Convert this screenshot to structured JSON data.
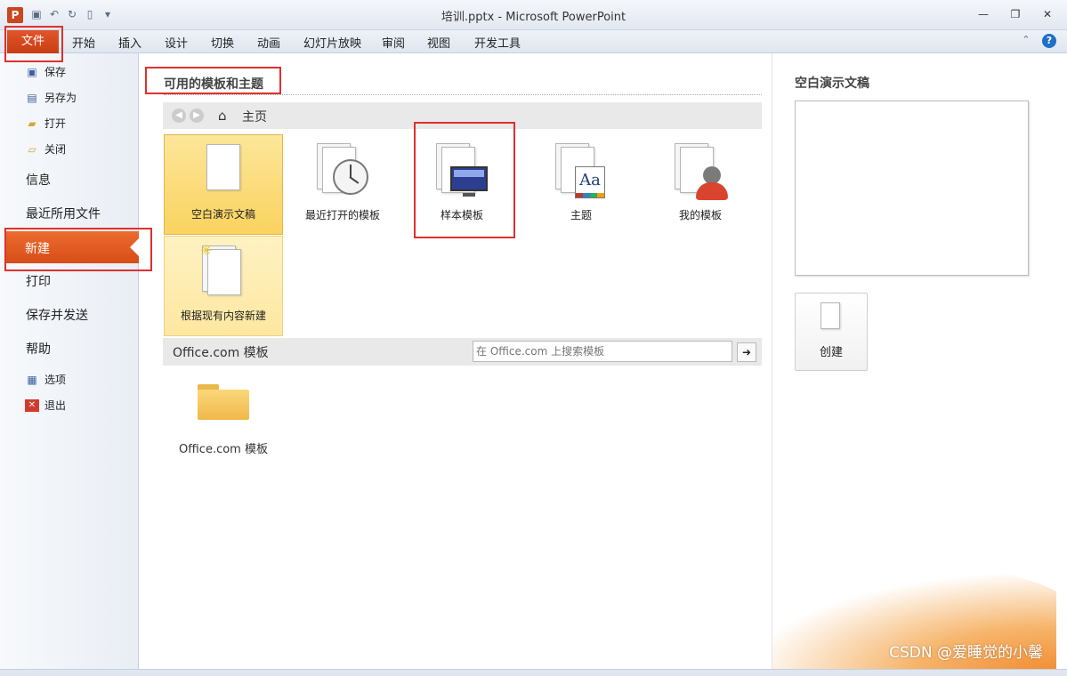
{
  "window": {
    "title": "培训.pptx - Microsoft PowerPoint",
    "app_icon_letter": "P",
    "icons": [
      "save-icon",
      "undo-icon",
      "redo-icon",
      "new-icon",
      "customize-qat-icon",
      "minimize-icon",
      "restore-icon",
      "close-icon"
    ]
  },
  "ribbon": {
    "file_tab": "文件",
    "tabs": [
      "开始",
      "插入",
      "设计",
      "切换",
      "动画",
      "幻灯片放映",
      "审阅",
      "视图",
      "开发工具"
    ]
  },
  "backstage_nav": {
    "save": "保存",
    "save_as": "另存为",
    "open": "打开",
    "close": "关闭",
    "info": "信息",
    "recent": "最近所用文件",
    "new": "新建",
    "print": "打印",
    "save_send": "保存并发送",
    "help": "帮助",
    "options": "选项",
    "exit": "退出"
  },
  "templates": {
    "section_title": "可用的模板和主题",
    "breadcrumb_home": "主页",
    "tiles": [
      {
        "label": "空白演示文稿",
        "icon": "blank-document-icon"
      },
      {
        "label": "最近打开的模板",
        "icon": "recent-templates-clock-icon"
      },
      {
        "label": "样本模板",
        "icon": "sample-templates-monitor-icon"
      },
      {
        "label": "主题",
        "icon": "themes-aa-icon"
      },
      {
        "label": "我的模板",
        "icon": "my-templates-person-icon"
      },
      {
        "label": "根据现有内容新建",
        "icon": "new-from-existing-icon"
      }
    ],
    "office_section_title": "Office.com 模板",
    "search_placeholder": "在 Office.com 上搜索模板",
    "office_folder_label": "Office.com 模板"
  },
  "preview": {
    "title": "空白演示文稿",
    "create_label": "创建"
  },
  "watermark": "CSDN @爱睡觉的小馨",
  "colors": {
    "accent_orange": "#d74d18",
    "selected_tile": "#fad35f",
    "annotation_red": "#e0302e"
  }
}
